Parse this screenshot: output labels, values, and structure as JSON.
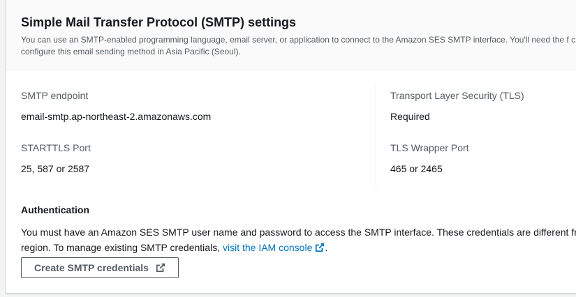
{
  "header": {
    "title": "Simple Mail Transfer Protocol (SMTP) settings",
    "description": "You can use an SMTP-enabled programming language, email server, or application to connect to the Amazon SES SMTP interface. You'll need the f credentials to configure this email sending method in Asia Pacific (Seoul)."
  },
  "settings": {
    "smtp_endpoint_label": "SMTP endpoint",
    "smtp_endpoint_value": "email-smtp.ap-northeast-2.amazonaws.com",
    "starttls_port_label": "STARTTLS Port",
    "starttls_port_value": "25, 587 or 2587",
    "tls_label": "Transport Layer Security (TLS)",
    "tls_value": "Required",
    "tls_wrapper_port_label": "TLS Wrapper Port",
    "tls_wrapper_port_value": "465 or 2465"
  },
  "authentication": {
    "title": "Authentication",
    "text_before_link": "You must have an Amazon SES SMTP user name and password to access the SMTP interface. These credentials are different fr unique to each region. To manage existing SMTP credentials, ",
    "link_text": "visit the IAM console",
    "text_after_link": ".",
    "button_label": "Create SMTP credentials"
  },
  "icons": {
    "external_link": "external-link-icon"
  },
  "colors": {
    "link": "#0073bb",
    "button_border": "#545b64",
    "header_bg": "#fafafa"
  }
}
